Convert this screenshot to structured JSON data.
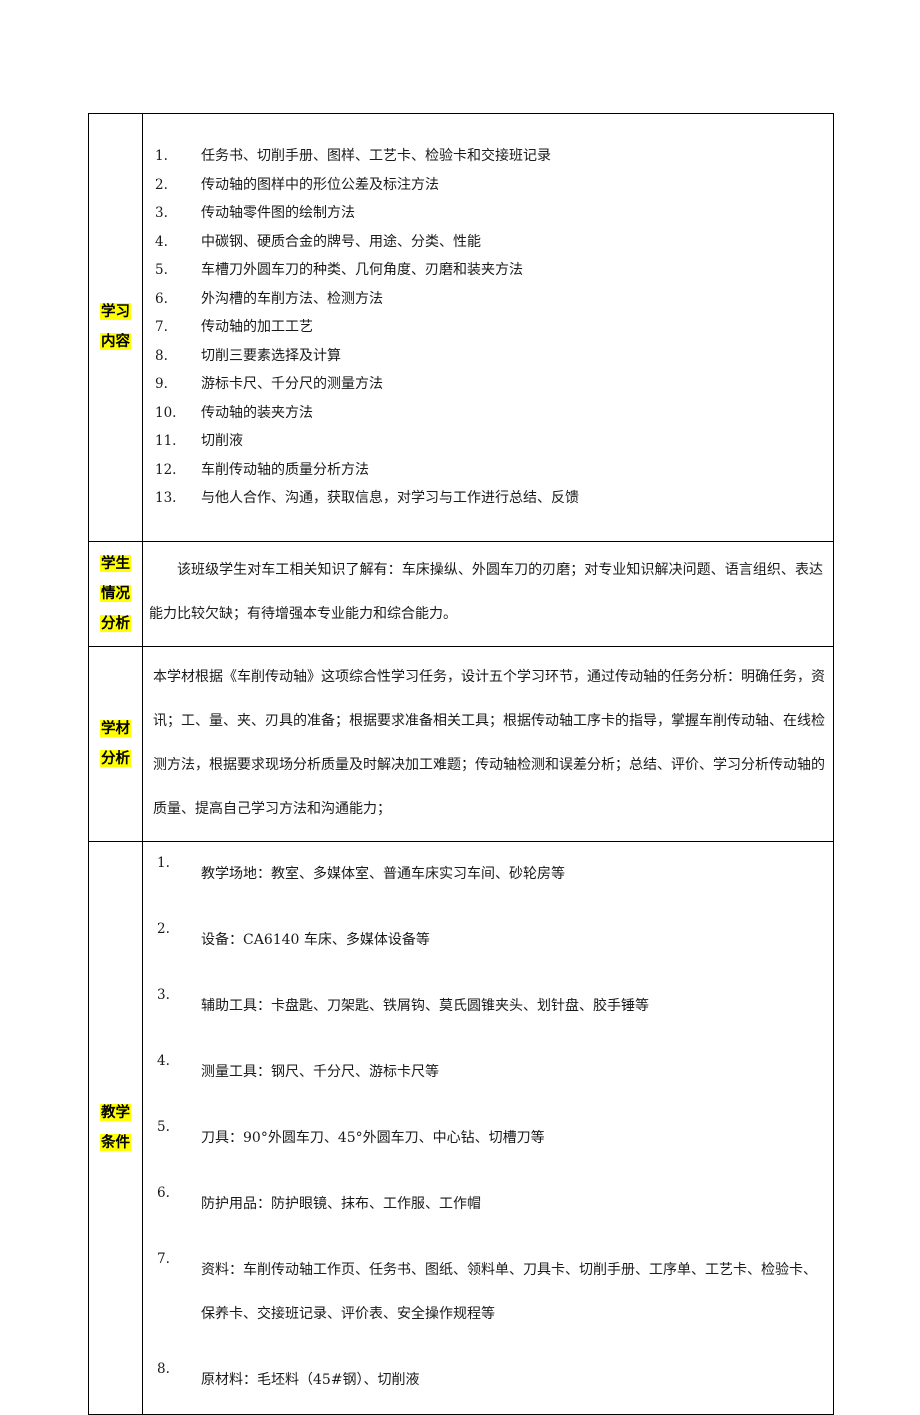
{
  "document": {
    "highlight_color": "#ffff00",
    "rows": [
      {
        "key": "learning_contents",
        "label_lines": [
          "学习",
          "内容"
        ],
        "items": [
          {
            "num": "1.",
            "text": "任务书、切削手册、图样、工艺卡、检验卡和交接班记录"
          },
          {
            "num": "2.",
            "text": "传动轴的图样中的形位公差及标注方法"
          },
          {
            "num": "3.",
            "text": "传动轴零件图的绘制方法"
          },
          {
            "num": "4.",
            "text": "中碳钢、硬质合金的牌号、用途、分类、性能"
          },
          {
            "num": "5.",
            "text": "车槽刀外圆车刀的种类、几何角度、刃磨和装夹方法"
          },
          {
            "num": "6.",
            "text": "外沟槽的车削方法、检测方法"
          },
          {
            "num": "7.",
            "text": "传动轴的加工工艺"
          },
          {
            "num": "8.",
            "text": "切削三要素选择及计算"
          },
          {
            "num": "9.",
            "text": "游标卡尺、千分尺的测量方法"
          },
          {
            "num": "10.",
            "text": "传动轴的装夹方法"
          },
          {
            "num": "11.",
            "text": "切削液"
          },
          {
            "num": "12.",
            "text": "车削传动轴的质量分析方法"
          },
          {
            "num": "13.",
            "text": "与他人合作、沟通，获取信息，对学习与工作进行总结、反馈"
          }
        ]
      },
      {
        "key": "student_situation_analysis",
        "label_lines": [
          "学生",
          "情况",
          "分析"
        ],
        "paragraphs": [
          "该班级学生对车工相关知识了解有：车床操纵、外圆车刀的刃磨；对专业知识解决问题、语言组织、表达能力比较欠缺；有待增强本专业能力和综合能力。"
        ]
      },
      {
        "key": "material_analysis",
        "label_lines": [
          "学材",
          "分析"
        ],
        "paragraphs": [
          "本学材根据《车削传动轴》这项综合性学习任务，设计五个学习环节，通过传动轴的任务分析：明确任务，资讯；工、量、夹、刃具的准备；根据要求准备相关工具；根据传动轴工序卡的指导，掌握车削传动轴、在线检测方法，根据要求现场分析质量及时解决加工难题；传动轴检测和误差分析；总结、评价、学习分析传动轴的质量、提高自己学习方法和沟通能力；"
        ]
      },
      {
        "key": "teaching_conditions",
        "label_lines": [
          "教学",
          "条件"
        ],
        "items": [
          {
            "num": "1.",
            "text": "教学场地：教室、多媒体室、普通车床实习车间、砂轮房等"
          },
          {
            "num": "2.",
            "text": "设备：CA6140 车床、多媒体设备等"
          },
          {
            "num": "3.",
            "text": "辅助工具：卡盘匙、刀架匙、铁屑钩、莫氏圆锥夹头、划针盘、胶手锤等"
          },
          {
            "num": "4.",
            "text": "测量工具：钢尺、千分尺、游标卡尺等"
          },
          {
            "num": "5.",
            "text": "刀具：90°外圆车刀、45°外圆车刀、中心钻、切槽刀等"
          },
          {
            "num": "6.",
            "text": "防护用品：防护眼镜、抹布、工作服、工作帽"
          },
          {
            "num": "7.",
            "text": "资料：车削传动轴工作页、任务书、图纸、领料单、刀具卡、切削手册、工序单、工艺卡、检验卡、保养卡、交接班记录、评价表、安全操作规程等"
          },
          {
            "num": "8.",
            "text": "原材料：毛坯料（45#钢）、切削液"
          }
        ]
      }
    ]
  }
}
